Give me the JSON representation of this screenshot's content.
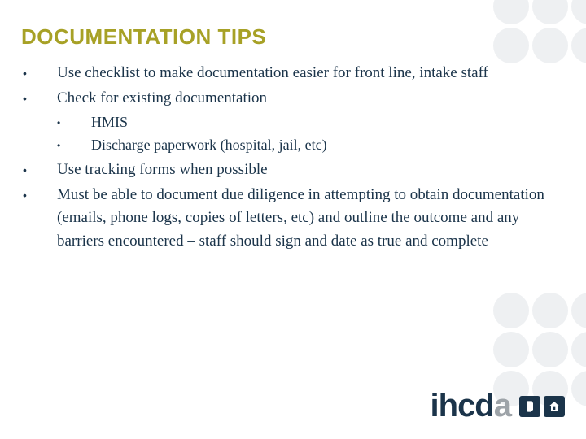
{
  "title": "DOCUMENTATION TIPS",
  "bullets": {
    "b0": "Use checklist to make documentation easier for front line, intake staff",
    "b1": "Check for existing documentation",
    "b1_sub0": "HMIS",
    "b1_sub1": "Discharge paperwork (hospital, jail, etc)",
    "b2": "Use tracking forms when possible",
    "b3": "Must be able to document due diligence in attempting to obtain documentation (emails, phone logs, copies of letters, etc) and outline the outcome and any barriers encountered – staff should sign and date as true and complete"
  },
  "logo": {
    "text_primary": "ihcd",
    "text_secondary": "a"
  }
}
